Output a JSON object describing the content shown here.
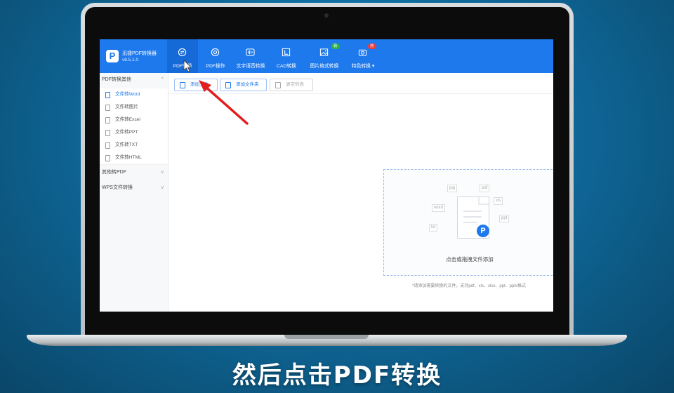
{
  "app": {
    "title": "迅捷PDF转换器",
    "version": "v8.5.1.0",
    "logo_letter": "P"
  },
  "tabs": [
    {
      "label": "PDF转换",
      "icon": "convert-icon",
      "active": true
    },
    {
      "label": "PDF操作",
      "icon": "target-icon"
    },
    {
      "label": "文字语音转换",
      "icon": "audio-wave-icon"
    },
    {
      "label": "CAD转换",
      "icon": "cad-icon"
    },
    {
      "label": "图片格式转换",
      "icon": "image-icon",
      "badge": "新"
    },
    {
      "label": "特色转换",
      "icon": "camera-icon",
      "badge": "热"
    }
  ],
  "colors": {
    "brand": "#1e79ec",
    "badge_new": "#2bb44a",
    "badge_hot": "#ee3a3a",
    "arrow": "#e11d1d"
  },
  "sidebar": {
    "groups": [
      {
        "label": "PDF转换其他",
        "expanded": true,
        "items": [
          {
            "label": "文件转Word",
            "selected": true
          },
          {
            "label": "文件转图片"
          },
          {
            "label": "文件转Excel"
          },
          {
            "label": "文件转PPT"
          },
          {
            "label": "文件转TXT"
          },
          {
            "label": "文件转HTML"
          }
        ]
      },
      {
        "label": "其他转PDF",
        "expanded": false
      },
      {
        "label": "WPS文件转换",
        "expanded": false
      }
    ]
  },
  "toolbar": {
    "add_file": "添加文件",
    "add_folder": "添加文件夹",
    "clear_list": "清空列表"
  },
  "dropzone": {
    "hint": "点击或拖拽文件添加",
    "formats_note": "*请添加需要转换的文件，支持pdf、xls、xlsx、ppt、pptx格式",
    "chips": [
      "word",
      "ppt",
      "xls",
      "txt",
      "jpg",
      "pdf"
    ]
  },
  "caption": "然后点击PDF转换"
}
